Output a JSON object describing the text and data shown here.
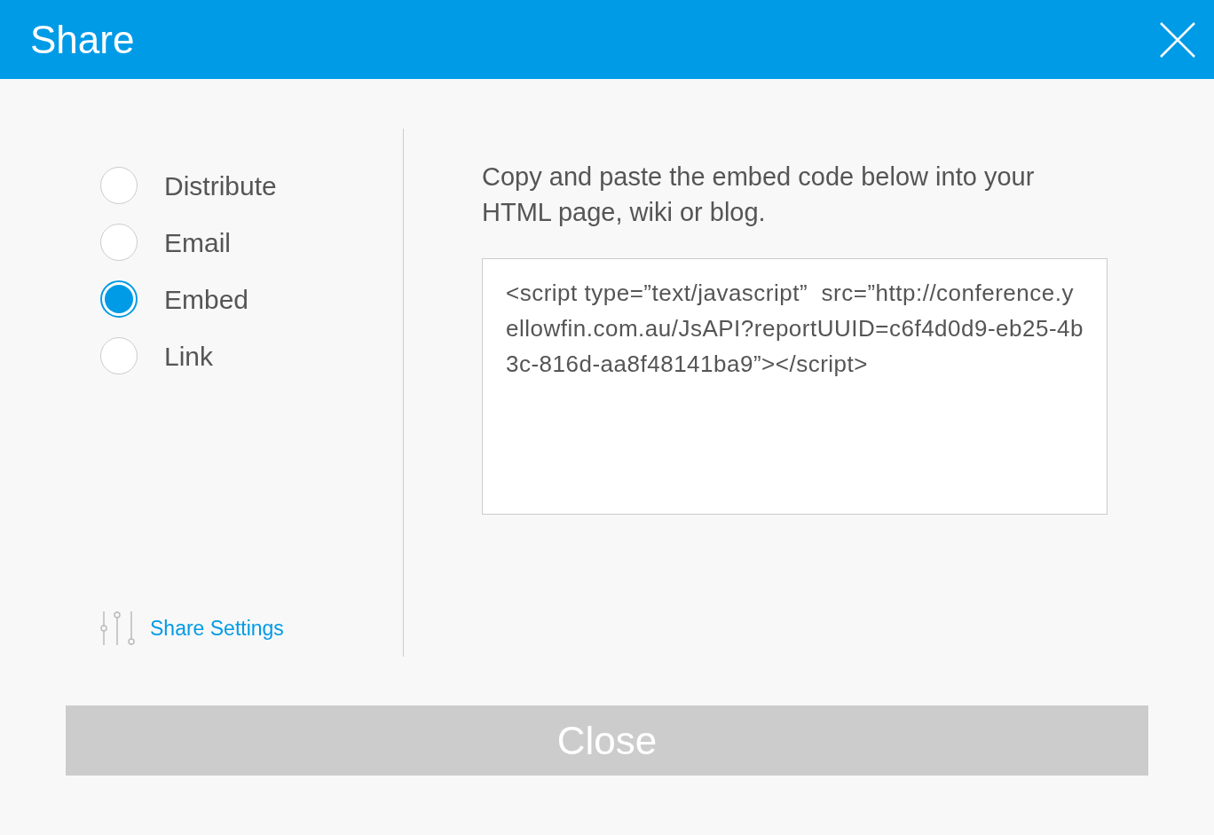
{
  "dialog": {
    "title": "Share"
  },
  "options": [
    {
      "label": "Distribute",
      "selected": false
    },
    {
      "label": "Email",
      "selected": false
    },
    {
      "label": "Embed",
      "selected": true
    },
    {
      "label": "Link",
      "selected": false
    }
  ],
  "settings_link": "Share Settings",
  "instructions": "Copy and paste the embed code below into your HTML page, wiki or blog.",
  "embed_code": "<script type=”text/javascript”  src=”http://conference.yellowfin.com.au/JsAPI?reportUUID=c6f4d0d9-eb25-4b3c-816d-aa8f48141ba9”></script>",
  "close_button": "Close"
}
